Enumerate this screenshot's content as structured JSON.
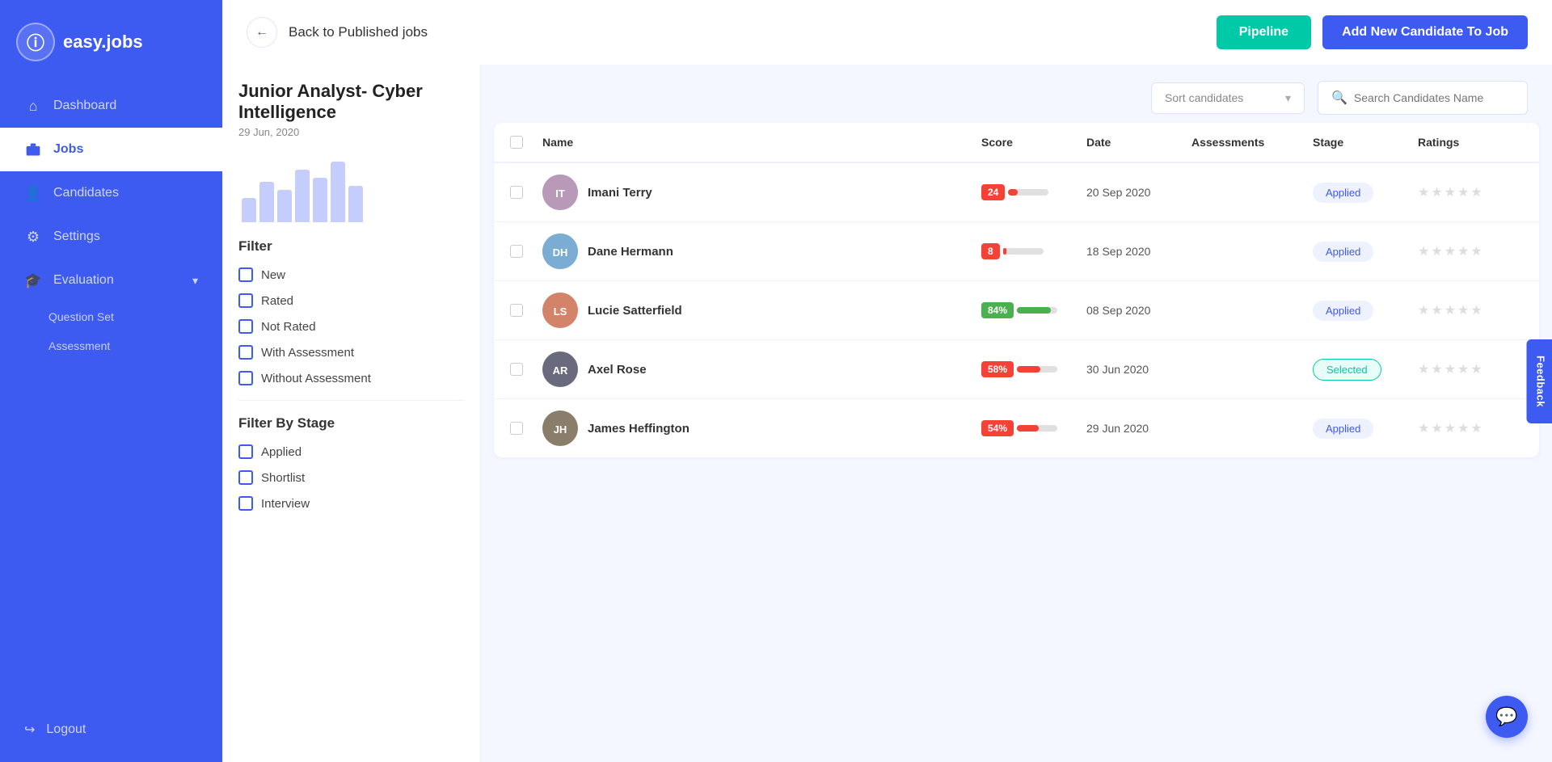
{
  "sidebar": {
    "logo": {
      "icon": "ⓘ",
      "text": "easy.jobs"
    },
    "nav_items": [
      {
        "id": "dashboard",
        "label": "Dashboard",
        "icon": "⌂",
        "active": false
      },
      {
        "id": "jobs",
        "label": "Jobs",
        "icon": "💼",
        "active": true
      },
      {
        "id": "candidates",
        "label": "Candidates",
        "icon": "👤",
        "active": false
      },
      {
        "id": "settings",
        "label": "Settings",
        "icon": "⚙",
        "active": false
      },
      {
        "id": "evaluation",
        "label": "Evaluation",
        "icon": "🎓",
        "active": false
      }
    ],
    "evaluation_sub": [
      {
        "id": "question-set",
        "label": "Question Set"
      },
      {
        "id": "assessment",
        "label": "Assessment"
      }
    ],
    "logout": {
      "icon": "↪",
      "label": "Logout"
    }
  },
  "header": {
    "back_label": "Back to Published jobs",
    "pipeline_btn": "Pipeline",
    "add_candidate_btn": "Add New Candidate To Job"
  },
  "job": {
    "title": "Junior Analyst- Cyber Intelligence",
    "date": "29 Jun, 2020"
  },
  "toolbar": {
    "sort_placeholder": "Sort candidates",
    "search_placeholder": "Search Candidates Name"
  },
  "table": {
    "columns": [
      "",
      "Name",
      "Score",
      "Date",
      "Assessments",
      "Stage",
      "Ratings"
    ],
    "rows": [
      {
        "id": 1,
        "name": "Imani Terry",
        "avatar_color": "#8b6f8b",
        "avatar_letter": "IT",
        "score_value": 24,
        "score_color": "#f44336",
        "date": "20 Sep 2020",
        "assessments": "",
        "stage": "Applied",
        "stage_type": "applied",
        "stars": [
          false,
          false,
          false,
          false,
          false
        ]
      },
      {
        "id": 2,
        "name": "Dane Hermann",
        "avatar_color": "#6b9fc4",
        "avatar_letter": "DH",
        "score_value": 8,
        "score_color": "#f44336",
        "date": "18 Sep 2020",
        "assessments": "",
        "stage": "Applied",
        "stage_type": "applied",
        "stars": [
          false,
          false,
          false,
          false,
          false
        ]
      },
      {
        "id": 3,
        "name": "Lucie Satterfield",
        "avatar_color": "#c4736b",
        "avatar_letter": "LS",
        "score_value": 84,
        "score_color": "#4caf50",
        "date": "08 Sep 2020",
        "assessments": "",
        "stage": "Applied",
        "stage_type": "applied",
        "stars": [
          false,
          false,
          false,
          false,
          false
        ]
      },
      {
        "id": 4,
        "name": "Axel Rose",
        "avatar_color": "#5a5a6e",
        "avatar_letter": "AR",
        "score_value": 58,
        "score_color": "#f44336",
        "date": "30 Jun 2020",
        "assessments": "",
        "stage": "Selected",
        "stage_type": "selected",
        "stars": [
          false,
          false,
          false,
          false,
          false
        ]
      },
      {
        "id": 5,
        "name": "James Heffington",
        "avatar_color": "#7a6e5a",
        "avatar_letter": "JH",
        "score_value": 54,
        "score_color": "#f44336",
        "date": "29 Jun 2020",
        "assessments": "",
        "stage": "Applied",
        "stage_type": "applied",
        "stars": [
          false,
          false,
          false,
          false,
          false
        ]
      }
    ]
  },
  "filter": {
    "title": "Filter",
    "items": [
      {
        "id": "new",
        "label": "New"
      },
      {
        "id": "rated",
        "label": "Rated"
      },
      {
        "id": "not-rated",
        "label": "Not Rated"
      },
      {
        "id": "with-assessment",
        "label": "With Assessment"
      },
      {
        "id": "without-assessment",
        "label": "Without Assessment"
      }
    ],
    "stage_title": "Filter By Stage",
    "stage_items": [
      {
        "id": "applied",
        "label": "Applied"
      },
      {
        "id": "shortlist",
        "label": "Shortlist"
      },
      {
        "id": "interview",
        "label": "Interview"
      }
    ]
  },
  "feedback": {
    "label": "Feedback"
  },
  "chat": {
    "icon": "💬"
  }
}
